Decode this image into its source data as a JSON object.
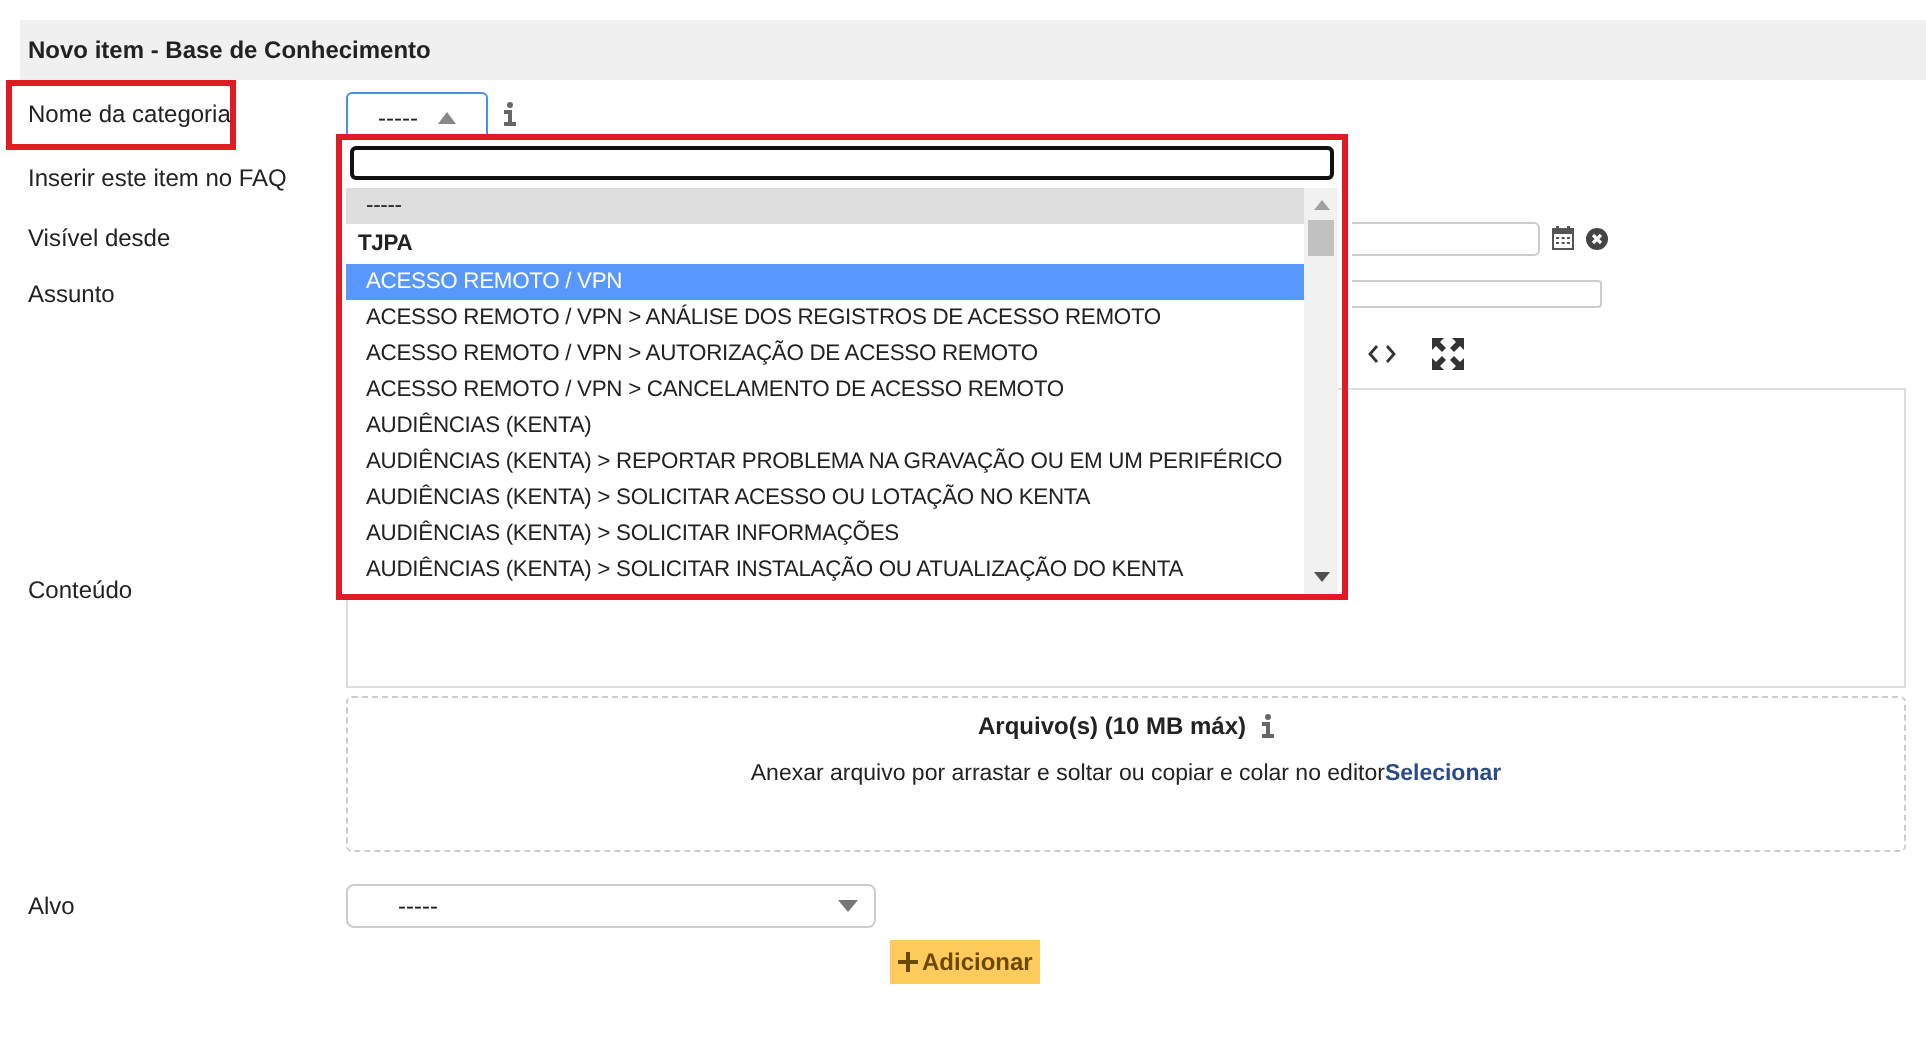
{
  "panel": {
    "title": "Novo item - Base de Conhecimento"
  },
  "form": {
    "category_label": "Nome da categoria",
    "category_value": "-----",
    "faq_label": "Inserir este item no FAQ",
    "visible_label": "Visível desde",
    "subject_label": "Assunto",
    "content_label": "Conteúdo",
    "target_label": "Alvo",
    "target_value": "-----"
  },
  "attachments": {
    "title": "Arquivo(s) (10 MB máx)",
    "hint": "Anexar arquivo por arrastar e soltar ou copiar e colar no editor",
    "link": "Selecionar"
  },
  "add_button": {
    "label": "Adicionar"
  },
  "dropdown": {
    "options": [
      {
        "kind": "option",
        "label": "-----",
        "selected": true,
        "highlighted": false
      },
      {
        "kind": "group",
        "label": "TJPA",
        "selected": false,
        "highlighted": false
      },
      {
        "kind": "option",
        "label": "ACESSO REMOTO / VPN",
        "selected": false,
        "highlighted": true
      },
      {
        "kind": "option",
        "label": "ACESSO REMOTO / VPN > ANÁLISE DOS REGISTROS DE ACESSO REMOTO",
        "selected": false,
        "highlighted": false
      },
      {
        "kind": "option",
        "label": "ACESSO REMOTO / VPN > AUTORIZAÇÃO DE ACESSO REMOTO",
        "selected": false,
        "highlighted": false
      },
      {
        "kind": "option",
        "label": "ACESSO REMOTO / VPN > CANCELAMENTO DE ACESSO REMOTO",
        "selected": false,
        "highlighted": false
      },
      {
        "kind": "option",
        "label": "AUDIÊNCIAS (KENTA)",
        "selected": false,
        "highlighted": false
      },
      {
        "kind": "option",
        "label": "AUDIÊNCIAS (KENTA) > REPORTAR PROBLEMA NA GRAVAÇÃO OU EM UM PERIFÉRICO",
        "selected": false,
        "highlighted": false
      },
      {
        "kind": "option",
        "label": "AUDIÊNCIAS (KENTA) > SOLICITAR ACESSO OU LOTAÇÃO NO KENTA",
        "selected": false,
        "highlighted": false
      },
      {
        "kind": "option",
        "label": "AUDIÊNCIAS (KENTA) > SOLICITAR INFORMAÇÕES",
        "selected": false,
        "highlighted": false
      },
      {
        "kind": "option",
        "label": "AUDIÊNCIAS (KENTA) > SOLICITAR INSTALAÇÃO OU ATUALIZAÇÃO DO KENTA",
        "selected": false,
        "highlighted": false
      }
    ]
  }
}
